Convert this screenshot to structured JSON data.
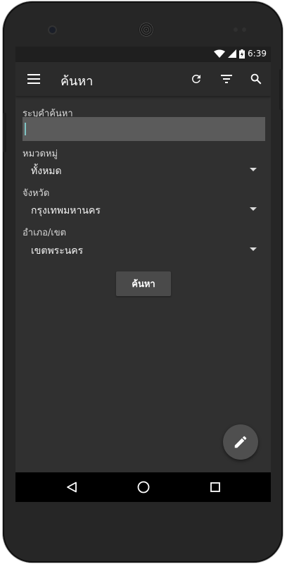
{
  "status_bar": {
    "time": "6:39"
  },
  "toolbar": {
    "title": "ค้นหา"
  },
  "form": {
    "keyword_label": "ระบุคำค้นหา",
    "keyword_value": "",
    "category_label": "หมวดหมู่",
    "category_value": "ทั้งหมด",
    "province_label": "จังหวัด",
    "province_value": "กรุงเทพมหานคร",
    "district_label": "อำเภอ/เขต",
    "district_value": "เขตพระนคร",
    "search_button": "ค้นหา"
  },
  "icons": {
    "menu": "menu-icon",
    "refresh": "refresh-icon",
    "filter": "filter-icon",
    "search": "search-icon",
    "fab": "pencil-icon",
    "nav_back": "back-triangle-icon",
    "nav_home": "home-circle-icon",
    "nav_recents": "recents-square-icon"
  },
  "colors": {
    "background": "#303030",
    "toolbar": "#2b2b2b",
    "input": "#5b5b5b",
    "accent": "#7fc4c4"
  }
}
